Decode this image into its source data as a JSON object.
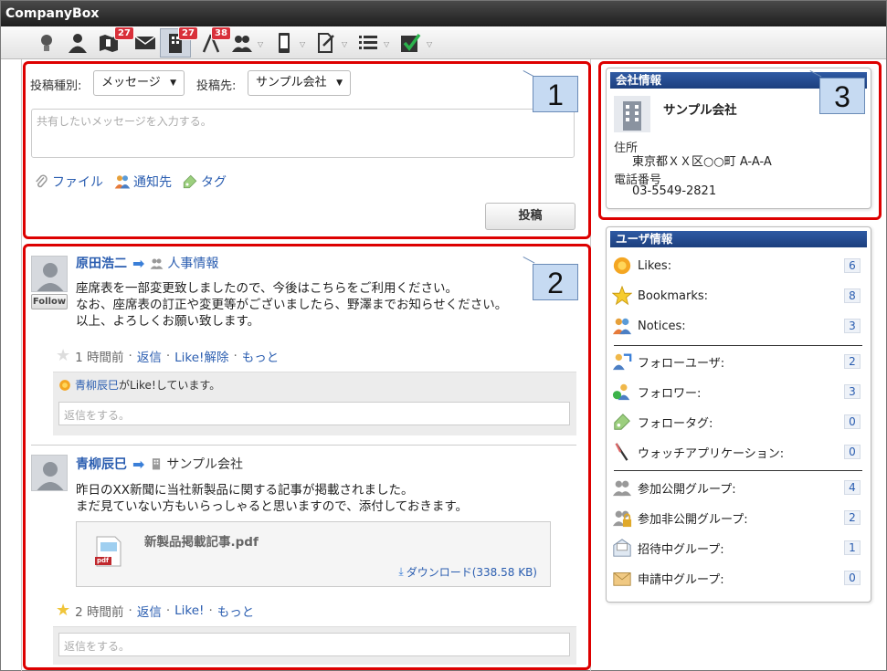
{
  "app": {
    "title": "CompanyBox"
  },
  "toolbar": {
    "badges": {
      "notifications": "27",
      "company": "27",
      "applications": "38"
    }
  },
  "post_form": {
    "type_label": "投稿種別:",
    "type_value": "メッセージ",
    "target_label": "投稿先:",
    "target_value": "サンプル会社",
    "placeholder": "共有したいメッセージを入力する。",
    "file_label": "ファイル",
    "notify_label": "通知先",
    "tag_label": "タグ",
    "submit_label": "投稿"
  },
  "callouts": [
    "1",
    "2",
    "3"
  ],
  "posts": [
    {
      "author": "原田浩二",
      "target": "人事情報",
      "follow_label": "Follow",
      "lines": [
        "座席表を一部変更致しましたので、今後はこちらをご利用ください。",
        "なお、座席表の訂正や変更等がございましたら、野澤までお知らせください。",
        "以上、よろしくお願い致します。"
      ],
      "time": "1 時間前",
      "reply": "返信",
      "like": "Like!解除",
      "more": "もっと",
      "liker_name": "青柳辰巳",
      "liker_text": "がLike!しています。",
      "reply_placeholder": "返信をする。"
    },
    {
      "author": "青柳辰巳",
      "target": "サンプル会社",
      "lines": [
        "昨日のXX新聞に当社新製品に関する記事が掲載されました。",
        "まだ見ていない方もいらっしゃると思いますので、添付しておきます。"
      ],
      "file_name": "新製品掲載記事.pdf",
      "file_type": "pdf",
      "download": "ダウンロード(338.58 KB)",
      "time": "2 時間前",
      "reply": "返信",
      "like": "Like!",
      "more": "もっと",
      "reply_placeholder": "返信をする。"
    }
  ],
  "company_info": {
    "heading": "会社情報",
    "name": "サンプル会社",
    "address_label": "住所",
    "address": "東京都ＸＸ区○○町 A-A-A",
    "phone_label": "電話番号",
    "phone": "03-5549-2821"
  },
  "user_info": {
    "heading": "ユーザ情報",
    "rows": [
      {
        "label": "Likes:",
        "count": "6",
        "icon": "like-icon"
      },
      {
        "label": "Bookmarks:",
        "count": "8",
        "icon": "star-icon"
      },
      {
        "label": "Notices:",
        "count": "3",
        "icon": "notice-icon"
      },
      {
        "label": "フォローユーザ:",
        "count": "2",
        "icon": "follow-user-icon"
      },
      {
        "label": "フォロワー:",
        "count": "3",
        "icon": "follower-icon"
      },
      {
        "label": "フォロータグ:",
        "count": "0",
        "icon": "tag-icon"
      },
      {
        "label": "ウォッチアプリケーション:",
        "count": "0",
        "icon": "watch-app-icon"
      },
      {
        "label": "参加公開グループ:",
        "count": "4",
        "icon": "public-group-icon"
      },
      {
        "label": "参加非公開グループ:",
        "count": "2",
        "icon": "private-group-icon"
      },
      {
        "label": "招待中グループ:",
        "count": "1",
        "icon": "invite-group-icon"
      },
      {
        "label": "申請中グループ:",
        "count": "0",
        "icon": "request-group-icon"
      }
    ]
  },
  "colors": {
    "accent_red": "#dd0000",
    "link": "#2a5db0",
    "panel_head": "#1c3f7e",
    "badge": "#d9303a"
  }
}
